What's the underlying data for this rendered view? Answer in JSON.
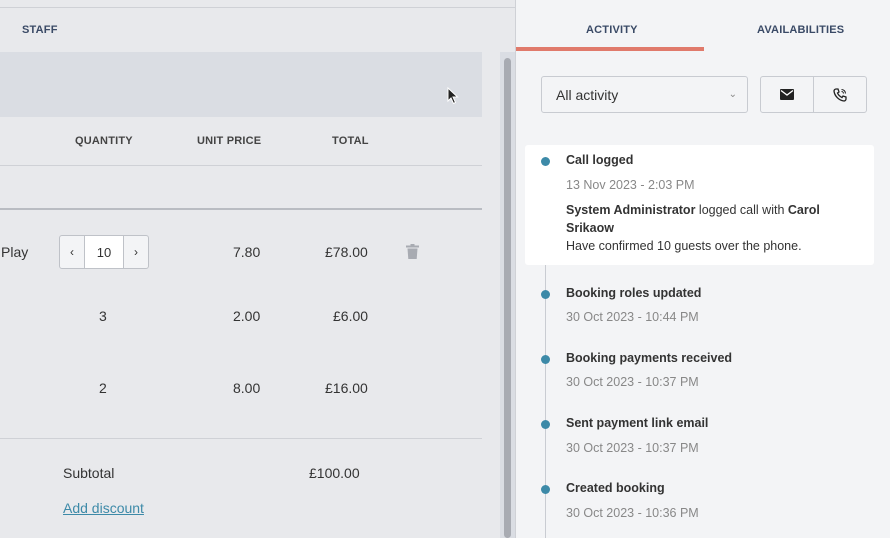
{
  "left": {
    "staff_tab": "STAFF",
    "columns": {
      "quantity": "QUANTITY",
      "unit_price": "UNIT PRICE",
      "total": "TOTAL"
    },
    "rows": [
      {
        "name_partial": "Play",
        "quantity": "10",
        "unit_price": "7.80",
        "total": "£78.00"
      },
      {
        "quantity": "3",
        "unit_price": "2.00",
        "total": "£6.00"
      },
      {
        "quantity": "2",
        "unit_price": "8.00",
        "total": "£16.00"
      }
    ],
    "subtotal_label": "Subtotal",
    "subtotal_value": "£100.00",
    "add_discount": "Add discount",
    "stepper_decrement": "‹",
    "stepper_increment": "›"
  },
  "right": {
    "tabs": [
      {
        "label": "ACTIVITY",
        "active": true
      },
      {
        "label": "AVAILABILITIES",
        "active": false
      }
    ],
    "filter_select": "All activity",
    "icons": {
      "email": "email-icon",
      "phone": "phone-icon",
      "trash": "trash-icon"
    },
    "events": [
      {
        "title": "Call logged",
        "time": "13 Nov 2023 - 2:03 PM",
        "actor": "System Administrator",
        "action": "logged call with",
        "target": "Carol Srikaow",
        "note": "Have confirmed 10 guests over the phone."
      },
      {
        "title": "Booking roles updated",
        "time": "30 Oct 2023 - 10:44 PM"
      },
      {
        "title": "Booking payments received",
        "time": "30 Oct 2023 - 10:37 PM"
      },
      {
        "title": "Sent payment link email",
        "time": "30 Oct 2023 - 10:37 PM"
      },
      {
        "title": "Created booking",
        "time": "30 Oct 2023 - 10:36 PM"
      }
    ]
  },
  "colors": {
    "accent": "#e07a6b",
    "timeline_dot": "#3d8aa8",
    "link": "#3d8aa8"
  }
}
